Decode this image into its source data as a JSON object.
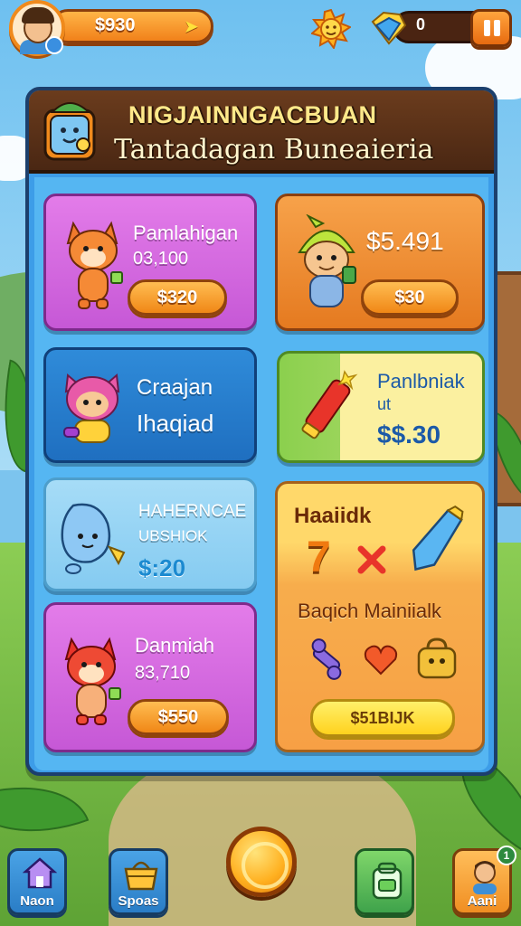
{
  "hud": {
    "coins": "$930",
    "gems": "0"
  },
  "panel": {
    "title": "NIGJAINNGACBUAN",
    "subtitle": "Tantadagan Buneaieria"
  },
  "cards": {
    "card1": {
      "name": "Pamlahigan",
      "sub": "03,100",
      "price": "$320"
    },
    "card2": {
      "price_top": "$5.491",
      "price": "$30"
    },
    "card3": {
      "name": "Craajan",
      "sub": "Ihaqiad"
    },
    "card4": {
      "name": "Panlbniak",
      "sub": "ut",
      "price": "$$.30"
    },
    "card5": {
      "name": "HAHERNCAE",
      "sub": "UBSHIOK",
      "price": "$:20"
    },
    "card6": {
      "title": "Haaiidk",
      "number": "7",
      "name": "Baqich Mainiialk",
      "price": "$51BIJK"
    },
    "card7": {
      "name": "Danmiah",
      "sub": "83,710",
      "price": "$550"
    }
  },
  "nav": {
    "home_label": "Naon",
    "shop_label": "Spoas",
    "profile_label": "Aani",
    "profile_badge": "1"
  },
  "colors": {
    "panel_blue": "#3d9de8",
    "header_brown": "#4a2713",
    "price_orange": "#f08716",
    "accent_yellow": "#ffd21e"
  }
}
